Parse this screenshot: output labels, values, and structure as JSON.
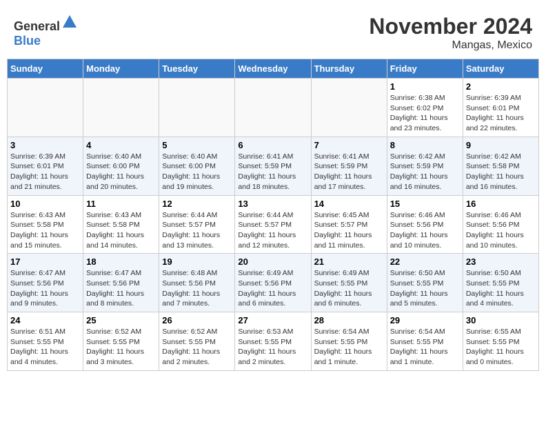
{
  "header": {
    "logo_general": "General",
    "logo_blue": "Blue",
    "month": "November 2024",
    "location": "Mangas, Mexico"
  },
  "weekdays": [
    "Sunday",
    "Monday",
    "Tuesday",
    "Wednesday",
    "Thursday",
    "Friday",
    "Saturday"
  ],
  "weeks": [
    [
      {
        "day": "",
        "info": ""
      },
      {
        "day": "",
        "info": ""
      },
      {
        "day": "",
        "info": ""
      },
      {
        "day": "",
        "info": ""
      },
      {
        "day": "",
        "info": ""
      },
      {
        "day": "1",
        "info": "Sunrise: 6:38 AM\nSunset: 6:02 PM\nDaylight: 11 hours and 23 minutes."
      },
      {
        "day": "2",
        "info": "Sunrise: 6:39 AM\nSunset: 6:01 PM\nDaylight: 11 hours and 22 minutes."
      }
    ],
    [
      {
        "day": "3",
        "info": "Sunrise: 6:39 AM\nSunset: 6:01 PM\nDaylight: 11 hours and 21 minutes."
      },
      {
        "day": "4",
        "info": "Sunrise: 6:40 AM\nSunset: 6:00 PM\nDaylight: 11 hours and 20 minutes."
      },
      {
        "day": "5",
        "info": "Sunrise: 6:40 AM\nSunset: 6:00 PM\nDaylight: 11 hours and 19 minutes."
      },
      {
        "day": "6",
        "info": "Sunrise: 6:41 AM\nSunset: 5:59 PM\nDaylight: 11 hours and 18 minutes."
      },
      {
        "day": "7",
        "info": "Sunrise: 6:41 AM\nSunset: 5:59 PM\nDaylight: 11 hours and 17 minutes."
      },
      {
        "day": "8",
        "info": "Sunrise: 6:42 AM\nSunset: 5:59 PM\nDaylight: 11 hours and 16 minutes."
      },
      {
        "day": "9",
        "info": "Sunrise: 6:42 AM\nSunset: 5:58 PM\nDaylight: 11 hours and 16 minutes."
      }
    ],
    [
      {
        "day": "10",
        "info": "Sunrise: 6:43 AM\nSunset: 5:58 PM\nDaylight: 11 hours and 15 minutes."
      },
      {
        "day": "11",
        "info": "Sunrise: 6:43 AM\nSunset: 5:58 PM\nDaylight: 11 hours and 14 minutes."
      },
      {
        "day": "12",
        "info": "Sunrise: 6:44 AM\nSunset: 5:57 PM\nDaylight: 11 hours and 13 minutes."
      },
      {
        "day": "13",
        "info": "Sunrise: 6:44 AM\nSunset: 5:57 PM\nDaylight: 11 hours and 12 minutes."
      },
      {
        "day": "14",
        "info": "Sunrise: 6:45 AM\nSunset: 5:57 PM\nDaylight: 11 hours and 11 minutes."
      },
      {
        "day": "15",
        "info": "Sunrise: 6:46 AM\nSunset: 5:56 PM\nDaylight: 11 hours and 10 minutes."
      },
      {
        "day": "16",
        "info": "Sunrise: 6:46 AM\nSunset: 5:56 PM\nDaylight: 11 hours and 10 minutes."
      }
    ],
    [
      {
        "day": "17",
        "info": "Sunrise: 6:47 AM\nSunset: 5:56 PM\nDaylight: 11 hours and 9 minutes."
      },
      {
        "day": "18",
        "info": "Sunrise: 6:47 AM\nSunset: 5:56 PM\nDaylight: 11 hours and 8 minutes."
      },
      {
        "day": "19",
        "info": "Sunrise: 6:48 AM\nSunset: 5:56 PM\nDaylight: 11 hours and 7 minutes."
      },
      {
        "day": "20",
        "info": "Sunrise: 6:49 AM\nSunset: 5:56 PM\nDaylight: 11 hours and 6 minutes."
      },
      {
        "day": "21",
        "info": "Sunrise: 6:49 AM\nSunset: 5:55 PM\nDaylight: 11 hours and 6 minutes."
      },
      {
        "day": "22",
        "info": "Sunrise: 6:50 AM\nSunset: 5:55 PM\nDaylight: 11 hours and 5 minutes."
      },
      {
        "day": "23",
        "info": "Sunrise: 6:50 AM\nSunset: 5:55 PM\nDaylight: 11 hours and 4 minutes."
      }
    ],
    [
      {
        "day": "24",
        "info": "Sunrise: 6:51 AM\nSunset: 5:55 PM\nDaylight: 11 hours and 4 minutes."
      },
      {
        "day": "25",
        "info": "Sunrise: 6:52 AM\nSunset: 5:55 PM\nDaylight: 11 hours and 3 minutes."
      },
      {
        "day": "26",
        "info": "Sunrise: 6:52 AM\nSunset: 5:55 PM\nDaylight: 11 hours and 2 minutes."
      },
      {
        "day": "27",
        "info": "Sunrise: 6:53 AM\nSunset: 5:55 PM\nDaylight: 11 hours and 2 minutes."
      },
      {
        "day": "28",
        "info": "Sunrise: 6:54 AM\nSunset: 5:55 PM\nDaylight: 11 hours and 1 minute."
      },
      {
        "day": "29",
        "info": "Sunrise: 6:54 AM\nSunset: 5:55 PM\nDaylight: 11 hours and 1 minute."
      },
      {
        "day": "30",
        "info": "Sunrise: 6:55 AM\nSunset: 5:55 PM\nDaylight: 11 hours and 0 minutes."
      }
    ]
  ]
}
